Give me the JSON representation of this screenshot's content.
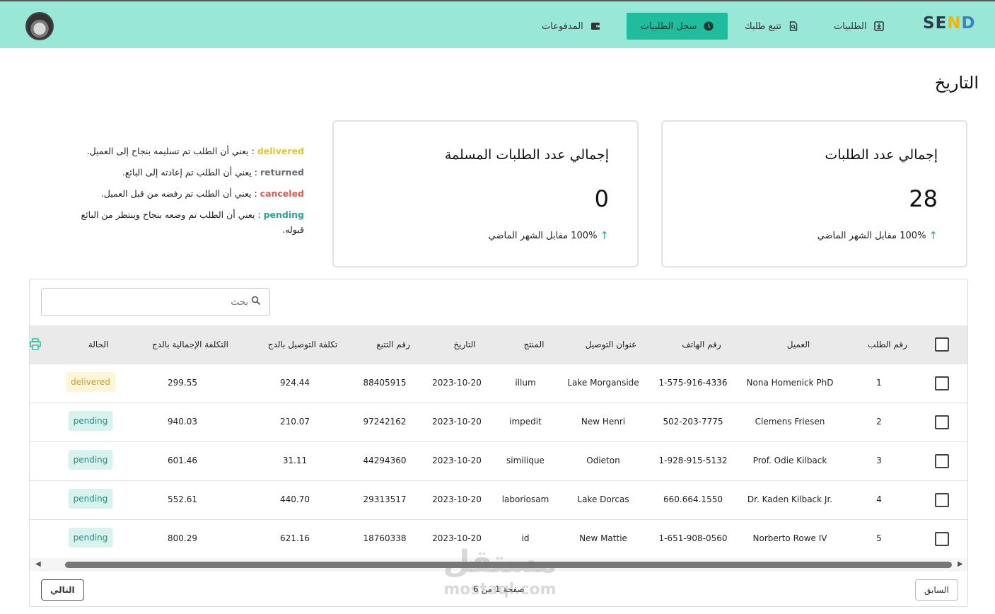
{
  "nav": {
    "logo": {
      "s": "SE",
      "n": "N",
      "d": "D"
    },
    "items": [
      {
        "label": "الطلبيات",
        "icon": "download-box-icon"
      },
      {
        "label": "تتبع طلبك",
        "icon": "search-document-icon"
      },
      {
        "label": "سجل الطلبيات",
        "icon": "clock-icon"
      },
      {
        "label": "المدفوعات",
        "icon": "wallet-icon"
      }
    ],
    "active_color": "#1fbd9d",
    "bar_color": "#99e7d6"
  },
  "page": {
    "title": "التاريخ"
  },
  "cards": [
    {
      "title": "إجمالي عدد الطلبات",
      "value": "28",
      "change": "100% مقابل الشهر الماضي"
    },
    {
      "title": "إجمالي عدد الطلبات المسلمة",
      "value": "0",
      "change": "100% مقابل الشهر الماضي"
    }
  ],
  "legend": [
    {
      "key": "delivered",
      "text": " : يعني أن الطلب تم تسليمه بنجاح إلى العميل."
    },
    {
      "key": "returned",
      "text": " : يعني أن الطلب تم إعادته إلى البائع."
    },
    {
      "key": "canceled",
      "text": " : يعني أن الطلب تم رفضه من قبل العميل."
    },
    {
      "key": "pending",
      "text": " : يعني أن الطلب تم وضعه بنجاح وينتظر من البائع قبوله."
    }
  ],
  "search": {
    "placeholder": "بحث"
  },
  "table": {
    "headers": [
      "رقم الطلب",
      "العميل",
      "رقم الهاتف",
      "عنوان التوصيل",
      "المنتج",
      "التاريخ",
      "رقم التتبع",
      "تكلفة التوصيل بالدج",
      "التكلفة الإجمالية بالدج",
      "الحالة"
    ],
    "rows": [
      {
        "id": "1",
        "customer": "Nona Homenick PhD",
        "phone": "1-575-916-4336",
        "address": "Lake Morganside",
        "product": "illum",
        "date": "2023-10-20",
        "tracking": "88405915",
        "delivery": "924.44",
        "total": "299.55",
        "status": "delivered"
      },
      {
        "id": "2",
        "customer": "Clemens Friesen",
        "phone": "502-203-7775",
        "address": "New Henri",
        "product": "impedit",
        "date": "2023-10-20",
        "tracking": "97242162",
        "delivery": "210.07",
        "total": "940.03",
        "status": "pending"
      },
      {
        "id": "3",
        "customer": "Prof. Odie Kilback",
        "phone": "1-928-915-5132",
        "address": "Odieton",
        "product": "similique",
        "date": "2023-10-20",
        "tracking": "44294360",
        "delivery": "31.11",
        "total": "601.46",
        "status": "pending"
      },
      {
        "id": "4",
        "customer": "Dr. Kaden Kilback Jr.",
        "phone": "660.664.1550",
        "address": "Lake Dorcas",
        "product": "laboriosam",
        "date": "2023-10-20",
        "tracking": "29313517",
        "delivery": "440.70",
        "total": "552.61",
        "status": "pending"
      },
      {
        "id": "5",
        "customer": "Norberto Rowe IV",
        "phone": "1-651-908-0560",
        "address": "New Mattie",
        "product": "id",
        "date": "2023-10-20",
        "tracking": "18760338",
        "delivery": "621.16",
        "total": "800.29",
        "status": "pending"
      }
    ]
  },
  "pagination": {
    "next_label": "التالي",
    "prev_label": "السابق",
    "info": "صفحة 1 من 6"
  },
  "watermark": {
    "ar": "مستقل",
    "en": "mostaql.com"
  }
}
